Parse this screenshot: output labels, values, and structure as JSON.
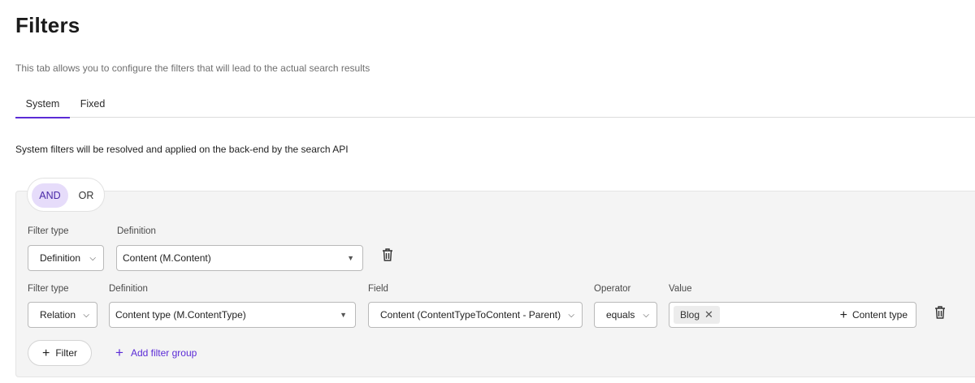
{
  "page": {
    "title": "Filters",
    "description": "This tab allows you to configure the filters that will lead to the actual search results"
  },
  "tabs": [
    {
      "label": "System",
      "active": true
    },
    {
      "label": "Fixed",
      "active": false
    }
  ],
  "section_description": "System filters will be resolved and applied on the back-end by the search API",
  "logic_toggle": {
    "and_label": "AND",
    "or_label": "OR",
    "selected": "AND"
  },
  "rows": [
    {
      "filter_type_label": "Filter type",
      "filter_type_value": "Definition",
      "definition_label": "Definition",
      "definition_value": "Content (M.Content)"
    },
    {
      "filter_type_label": "Filter type",
      "filter_type_value": "Relation",
      "definition_label": "Definition",
      "definition_value": "Content type (M.ContentType)",
      "field_label": "Field",
      "field_value": "Content (ContentTypeToContent - Parent)",
      "operator_label": "Operator",
      "operator_value": "equals",
      "value_label": "Value",
      "value_chips": [
        "Blog"
      ],
      "add_value_label": "Content type"
    }
  ],
  "actions": {
    "add_filter_label": "Filter",
    "add_filter_group_label": "Add filter group"
  },
  "colors": {
    "accent": "#5b2bd6",
    "toggle_selected_bg": "#e6dcfa",
    "group_bg": "#f4f4f4"
  },
  "icons": [
    "chevron-down-icon",
    "caret-down-icon",
    "trash-icon",
    "close-icon",
    "plus-icon"
  ]
}
